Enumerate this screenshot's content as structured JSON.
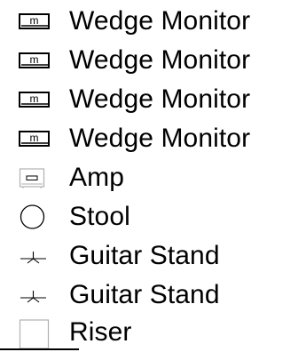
{
  "legend": {
    "items": [
      {
        "icon": "wedge-monitor-icon",
        "label": "Wedge Monitor"
      },
      {
        "icon": "wedge-monitor-icon",
        "label": "Wedge Monitor"
      },
      {
        "icon": "wedge-monitor-icon",
        "label": "Wedge Monitor"
      },
      {
        "icon": "wedge-monitor-icon",
        "label": "Wedge Monitor"
      },
      {
        "icon": "amp-icon",
        "label": "Amp"
      },
      {
        "icon": "stool-icon",
        "label": "Stool"
      },
      {
        "icon": "guitar-stand-icon",
        "label": "Guitar Stand"
      },
      {
        "icon": "guitar-stand-icon",
        "label": "Guitar Stand"
      },
      {
        "icon": "riser-icon",
        "label": "Riser"
      }
    ],
    "wedge_monitor_glyph": "m"
  },
  "colors": {
    "text": "#000000",
    "icon_stroke": "#000000",
    "icon_light_stroke": "#b0b0b0",
    "background": "#ffffff"
  }
}
